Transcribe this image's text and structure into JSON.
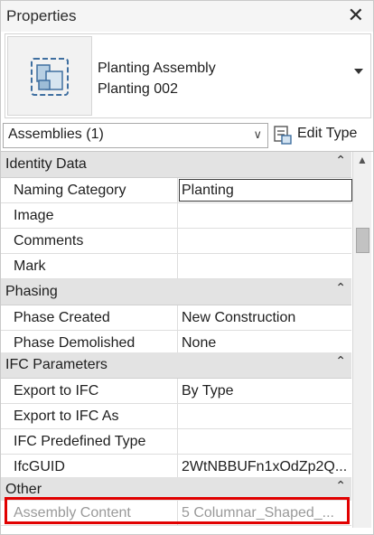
{
  "panel": {
    "title": "Properties",
    "close_glyph": "✕"
  },
  "type_selector": {
    "icon": "assembly-icon",
    "family": "Planting Assembly",
    "type": "Planting 002"
  },
  "filter": {
    "selected": "Assemblies (1)",
    "edit_type_label": "Edit Type",
    "edit_type_icon": "edit-type-icon"
  },
  "groups": {
    "identity": {
      "label": "Identity Data",
      "rows": [
        {
          "name": "Naming Category",
          "value": "Planting"
        },
        {
          "name": "Image",
          "value": ""
        },
        {
          "name": "Comments",
          "value": ""
        },
        {
          "name": "Mark",
          "value": ""
        }
      ]
    },
    "phasing": {
      "label": "Phasing",
      "rows": [
        {
          "name": "Phase Created",
          "value": "New Construction"
        },
        {
          "name": "Phase Demolished",
          "value": "None"
        }
      ]
    },
    "ifc": {
      "label": "IFC Parameters",
      "rows": [
        {
          "name": "Export to IFC",
          "value": "By Type"
        },
        {
          "name": "Export to IFC As",
          "value": ""
        },
        {
          "name": "IFC Predefined Type",
          "value": ""
        },
        {
          "name": "IfcGUID",
          "value": "2WtNBBUFn1xOdZp2Q..."
        }
      ]
    },
    "other": {
      "label": "Other",
      "rows": [
        {
          "name": "Assembly Content",
          "value": "5 Columnar_Shaped_..."
        }
      ]
    }
  },
  "colors": {
    "highlight": "#e10000",
    "group_bg": "#e3e3e3"
  }
}
